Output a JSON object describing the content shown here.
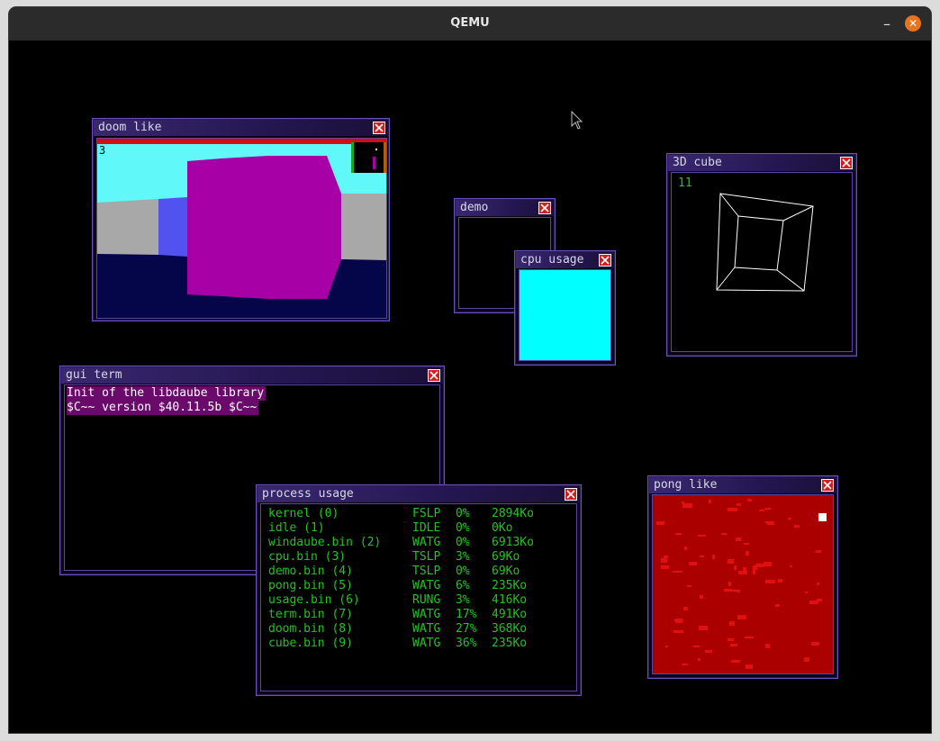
{
  "host_window": {
    "title": "QEMU",
    "minimize_glyph": "–",
    "close_glyph": "✕"
  },
  "windows": {
    "doom": {
      "title": "doom like",
      "counter": "3"
    },
    "demo": {
      "title": "demo"
    },
    "cpu": {
      "title": "cpu usage"
    },
    "cube": {
      "title": "3D cube",
      "counter": "11"
    },
    "term": {
      "title": "gui term",
      "lines": [
        "Init of the libdaube library",
        "$C~~ version $40.11.5b $C~~"
      ]
    },
    "process": {
      "title": "process usage",
      "rows": [
        {
          "name": "kernel (0)",
          "state": "FSLP",
          "cpu": "0%",
          "mem": "2894Ko"
        },
        {
          "name": "idle (1)",
          "state": "IDLE",
          "cpu": "0%",
          "mem": "0Ko"
        },
        {
          "name": "windaube.bin (2)",
          "state": "WATG",
          "cpu": "0%",
          "mem": "6913Ko"
        },
        {
          "name": "cpu.bin (3)",
          "state": "TSLP",
          "cpu": "3%",
          "mem": "69Ko"
        },
        {
          "name": "demo.bin (4)",
          "state": "TSLP",
          "cpu": "0%",
          "mem": "69Ko"
        },
        {
          "name": "pong.bin (5)",
          "state": "WATG",
          "cpu": "6%",
          "mem": "235Ko"
        },
        {
          "name": "usage.bin (6)",
          "state": "RUNG",
          "cpu": "3%",
          "mem": "416Ko"
        },
        {
          "name": "term.bin (7)",
          "state": "WATG",
          "cpu": "17%",
          "mem": "491Ko"
        },
        {
          "name": "doom.bin (8)",
          "state": "WATG",
          "cpu": "27%",
          "mem": "368Ko"
        },
        {
          "name": "cube.bin (9)",
          "state": "WATG",
          "cpu": "36%",
          "mem": "235Ko"
        }
      ]
    },
    "pong": {
      "title": "pong like"
    }
  },
  "colors": {
    "desktop": "#000000",
    "window_border": "#6a50b8",
    "process_text": "#22c422",
    "cube_counter": "#22c422",
    "cpu_fill": "#00ffff",
    "pong_bg": "#aa0000",
    "pong_speckle": "#e01010",
    "term_highlight": "#6a0a6a"
  },
  "icons": {
    "window_close": "close-x-icon",
    "mouse_cursor": "arrow-cursor-icon"
  }
}
